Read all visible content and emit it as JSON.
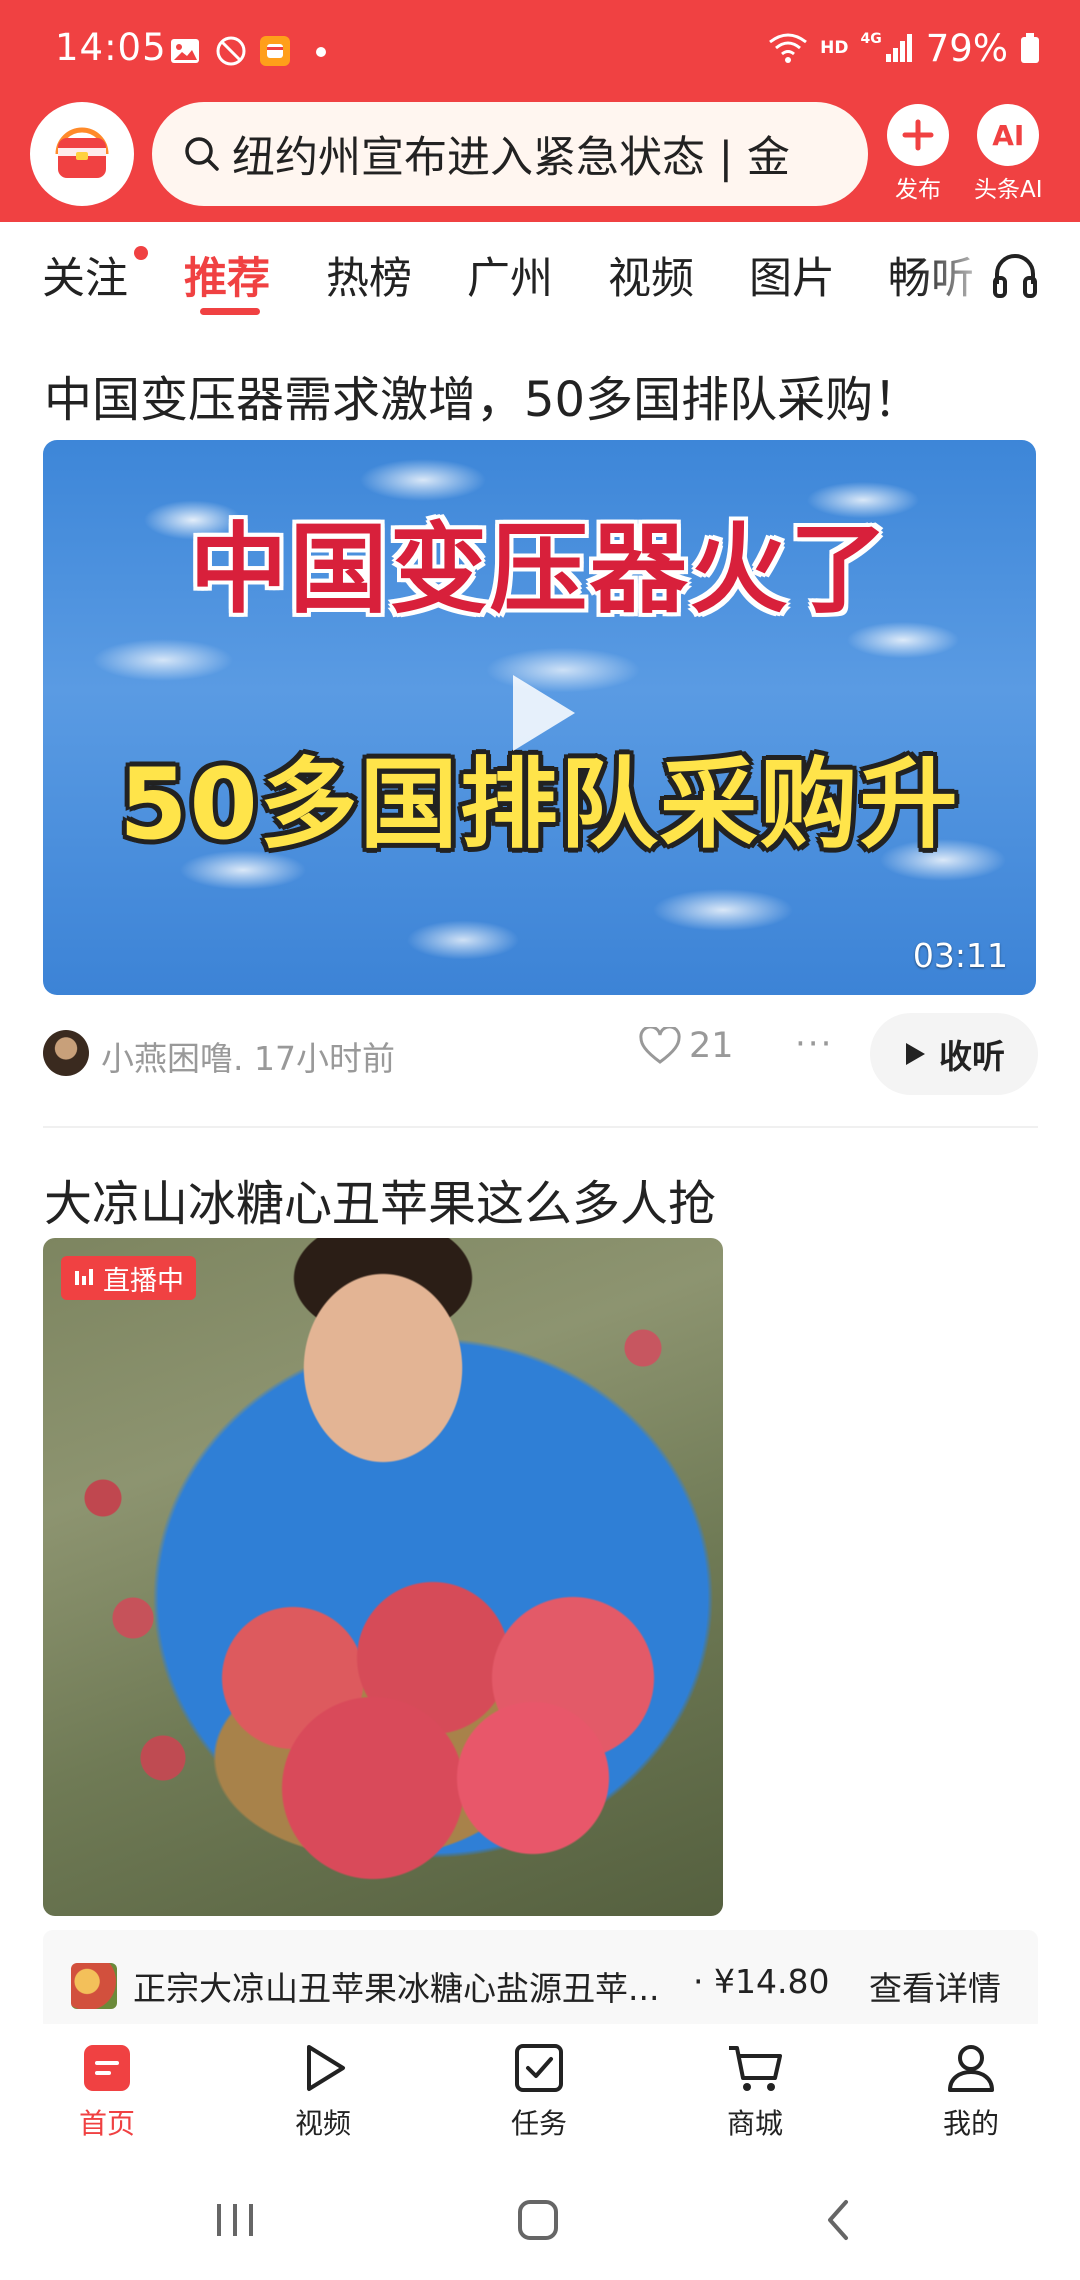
{
  "status_bar": {
    "time": "14:05",
    "network": "HD",
    "signal": "4G",
    "battery": "79%"
  },
  "header": {
    "search_text": "纽约州宣布进入紧急状态 | 金",
    "publish_label": "发布",
    "ai_label": "头条AI",
    "ai_glyph": "AI",
    "brand_color": "#f04142"
  },
  "tabs": [
    {
      "label": "关注",
      "has_dot": true
    },
    {
      "label": "推荐",
      "active": true
    },
    {
      "label": "热榜"
    },
    {
      "label": "广州"
    },
    {
      "label": "视频"
    },
    {
      "label": "图片"
    },
    {
      "label": "畅听"
    }
  ],
  "feed": [
    {
      "type": "video",
      "title": "中国变压器需求激增，50多国排队采购！",
      "overlay_line1": "中国变压器火了",
      "overlay_line2": "50多国排队采购升",
      "duration": "03:11",
      "author": "小燕困噜. 17小时前",
      "likes": "21",
      "more": "···",
      "listen_label": "收听"
    },
    {
      "type": "live",
      "title": "大凉山冰糖心丑苹果这么多人抢",
      "live_badge": "直播中",
      "product": {
        "name": "正宗大凉山丑苹果冰糖心盐源丑苹...",
        "price": "· ¥14.80",
        "detail_label": "查看详情"
      }
    }
  ],
  "bottom_nav": [
    {
      "label": "首页",
      "icon": "home-icon",
      "active": true
    },
    {
      "label": "视频",
      "icon": "play-icon"
    },
    {
      "label": "任务",
      "icon": "task-check-icon"
    },
    {
      "label": "商城",
      "icon": "cart-icon"
    },
    {
      "label": "我的",
      "icon": "person-icon"
    }
  ]
}
